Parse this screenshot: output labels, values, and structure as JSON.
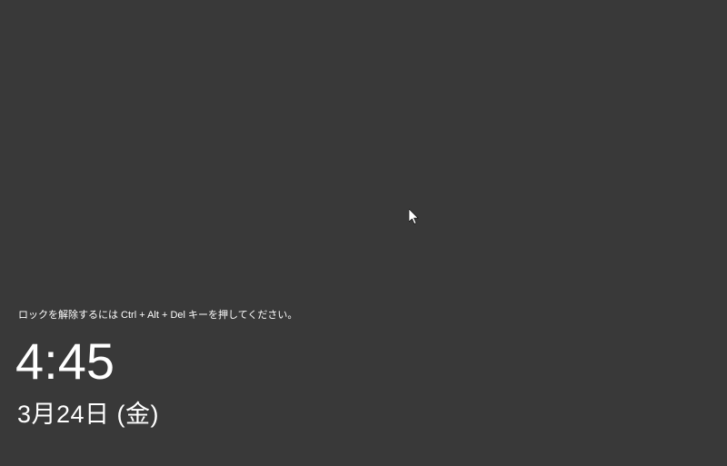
{
  "lockscreen": {
    "instruction": "ロックを解除するには Ctrl + Alt + Del キーを押してください。",
    "time": "4:45",
    "date": "3月24日 (金)"
  }
}
